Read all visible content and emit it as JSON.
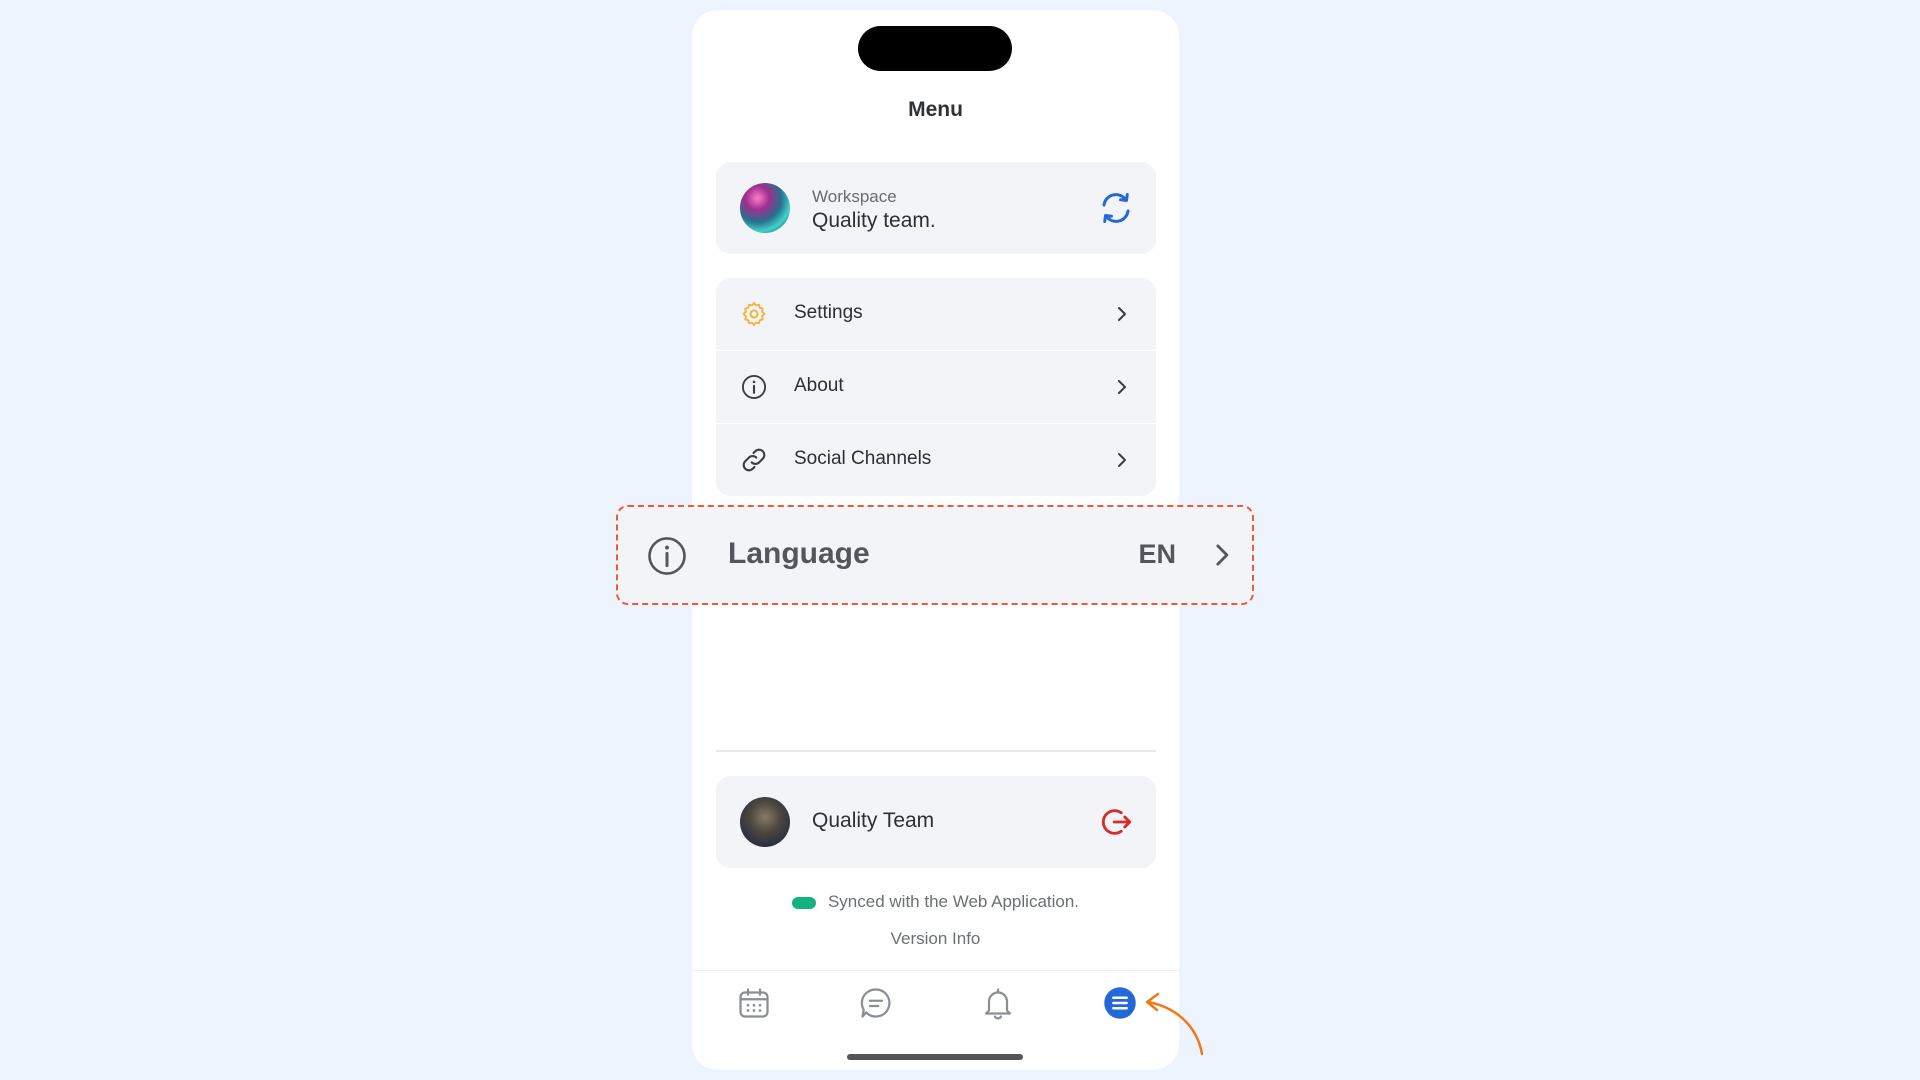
{
  "page": {
    "title": "Menu"
  },
  "workspace": {
    "label": "Workspace",
    "name": "Quality team."
  },
  "menu": {
    "items": [
      {
        "label": "Settings",
        "icon": "gear-icon"
      },
      {
        "label": "About",
        "icon": "info-icon"
      },
      {
        "label": "Social Channels",
        "icon": "link-icon"
      }
    ]
  },
  "language": {
    "label": "Language",
    "value": "EN",
    "icon": "info-icon"
  },
  "user": {
    "name": "Quality Team"
  },
  "status": {
    "sync_text": "Synced with the Web Application.",
    "version_text": "Version Info"
  },
  "tabbar": {
    "items": [
      {
        "icon": "calendar-icon",
        "active": false
      },
      {
        "icon": "chat-icon",
        "active": false
      },
      {
        "icon": "bell-icon",
        "active": false
      },
      {
        "icon": "menu-icon",
        "active": true
      }
    ]
  },
  "colors": {
    "background": "#eef4fd",
    "accent": "#2467d8",
    "settings_icon": "#f2b53a",
    "logout": "#d92b2b",
    "sync_ok": "#14b27f",
    "highlight_border": "#ef5a36",
    "annotation_arrow": "#f07a1a"
  }
}
